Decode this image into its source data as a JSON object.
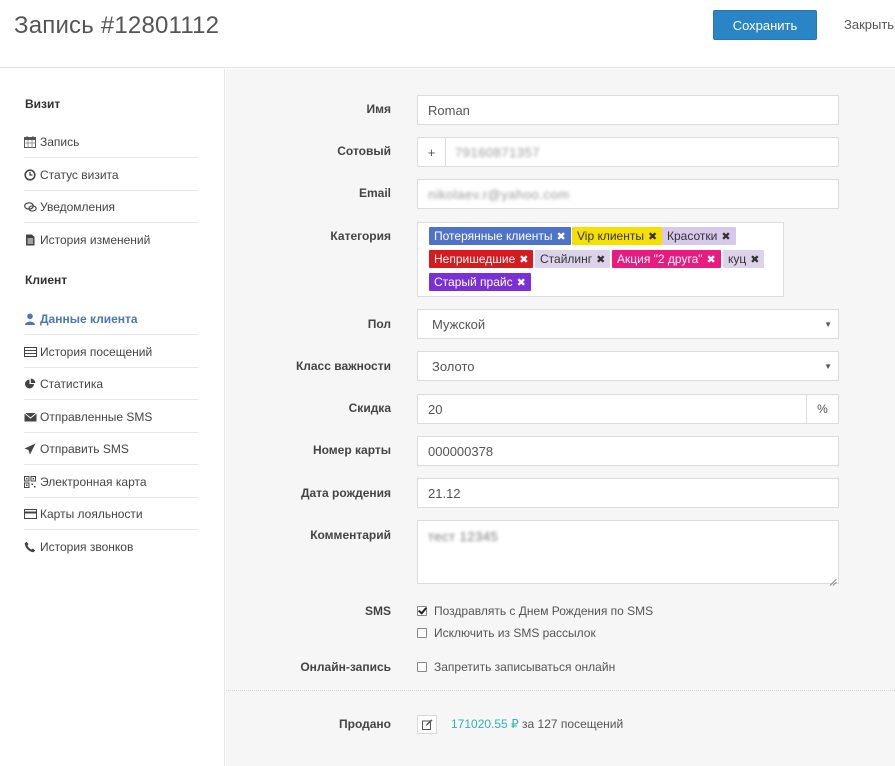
{
  "header": {
    "title": "Запись #12801112",
    "save_label": "Сохранить",
    "close_label": "Закрыть"
  },
  "sidebar": {
    "visit_section": "Визит",
    "visit_items": [
      {
        "label": "Запись",
        "icon": "calendar-icon"
      },
      {
        "label": "Статус визита",
        "icon": "clock-icon"
      },
      {
        "label": "Уведомления",
        "icon": "comments-icon"
      },
      {
        "label": "История изменений",
        "icon": "file-icon"
      }
    ],
    "client_section": "Клиент",
    "client_items": [
      {
        "label": "Данные клиента",
        "icon": "user-icon",
        "active": true
      },
      {
        "label": "История посещений",
        "icon": "list-icon"
      },
      {
        "label": "Статистика",
        "icon": "pie-chart-icon"
      },
      {
        "label": "Отправленные SMS",
        "icon": "envelope-icon"
      },
      {
        "label": "Отправить SMS",
        "icon": "send-icon"
      },
      {
        "label": "Электронная карта",
        "icon": "qr-icon"
      },
      {
        "label": "Карты лояльности",
        "icon": "credit-card-icon"
      },
      {
        "label": "История звонков",
        "icon": "phone-icon"
      }
    ]
  },
  "form": {
    "name": {
      "label": "Имя",
      "value": "Roman"
    },
    "phone": {
      "label": "Сотовый",
      "prefix": "+",
      "value": "79160871357"
    },
    "email": {
      "label": "Email",
      "value": "nikolaev.r@yahoo.com"
    },
    "category": {
      "label": "Категория",
      "tags": [
        {
          "text": "Потерянные клиенты",
          "bg": "#4f73c8",
          "fg": "#ffffff"
        },
        {
          "text": "Vip клиенты",
          "bg": "#f5e000",
          "fg": "#333333"
        },
        {
          "text": "Красотки",
          "bg": "#d6c9ea",
          "fg": "#333333"
        },
        {
          "text": "Непришедшие",
          "bg": "#d71920",
          "fg": "#ffffff"
        },
        {
          "text": "Стайлинг",
          "bg": "#dcd3ea",
          "fg": "#333333"
        },
        {
          "text": "Акция \"2 друга\"",
          "bg": "#ea1a7f",
          "fg": "#ffffff"
        },
        {
          "text": "куц",
          "bg": "#dcd3ea",
          "fg": "#333333"
        },
        {
          "text": "Старый прайс",
          "bg": "#7b2fd6",
          "fg": "#ffffff"
        }
      ]
    },
    "gender": {
      "label": "Пол",
      "value": "Мужской"
    },
    "importance": {
      "label": "Класс важности",
      "value": "Золото"
    },
    "discount": {
      "label": "Скидка",
      "value": "20",
      "unit": "%"
    },
    "card": {
      "label": "Номер карты",
      "value": "000000378"
    },
    "birthday": {
      "label": "Дата рождения",
      "value": "21.12"
    },
    "comment": {
      "label": "Комментарий",
      "value": "тест 12345"
    },
    "sms": {
      "label": "SMS",
      "options": [
        {
          "text": "Поздравлять с Днем Рождения по SMS",
          "checked": true
        },
        {
          "text": "Исключить из SMS рассылок",
          "checked": false
        }
      ]
    },
    "online": {
      "label": "Онлайн-запись",
      "option": {
        "text": "Запретить записываться онлайн",
        "checked": false
      }
    },
    "sold": {
      "label": "Продано",
      "amount": "171020.55 ₽",
      "suffix": " за 127 посещений"
    }
  }
}
